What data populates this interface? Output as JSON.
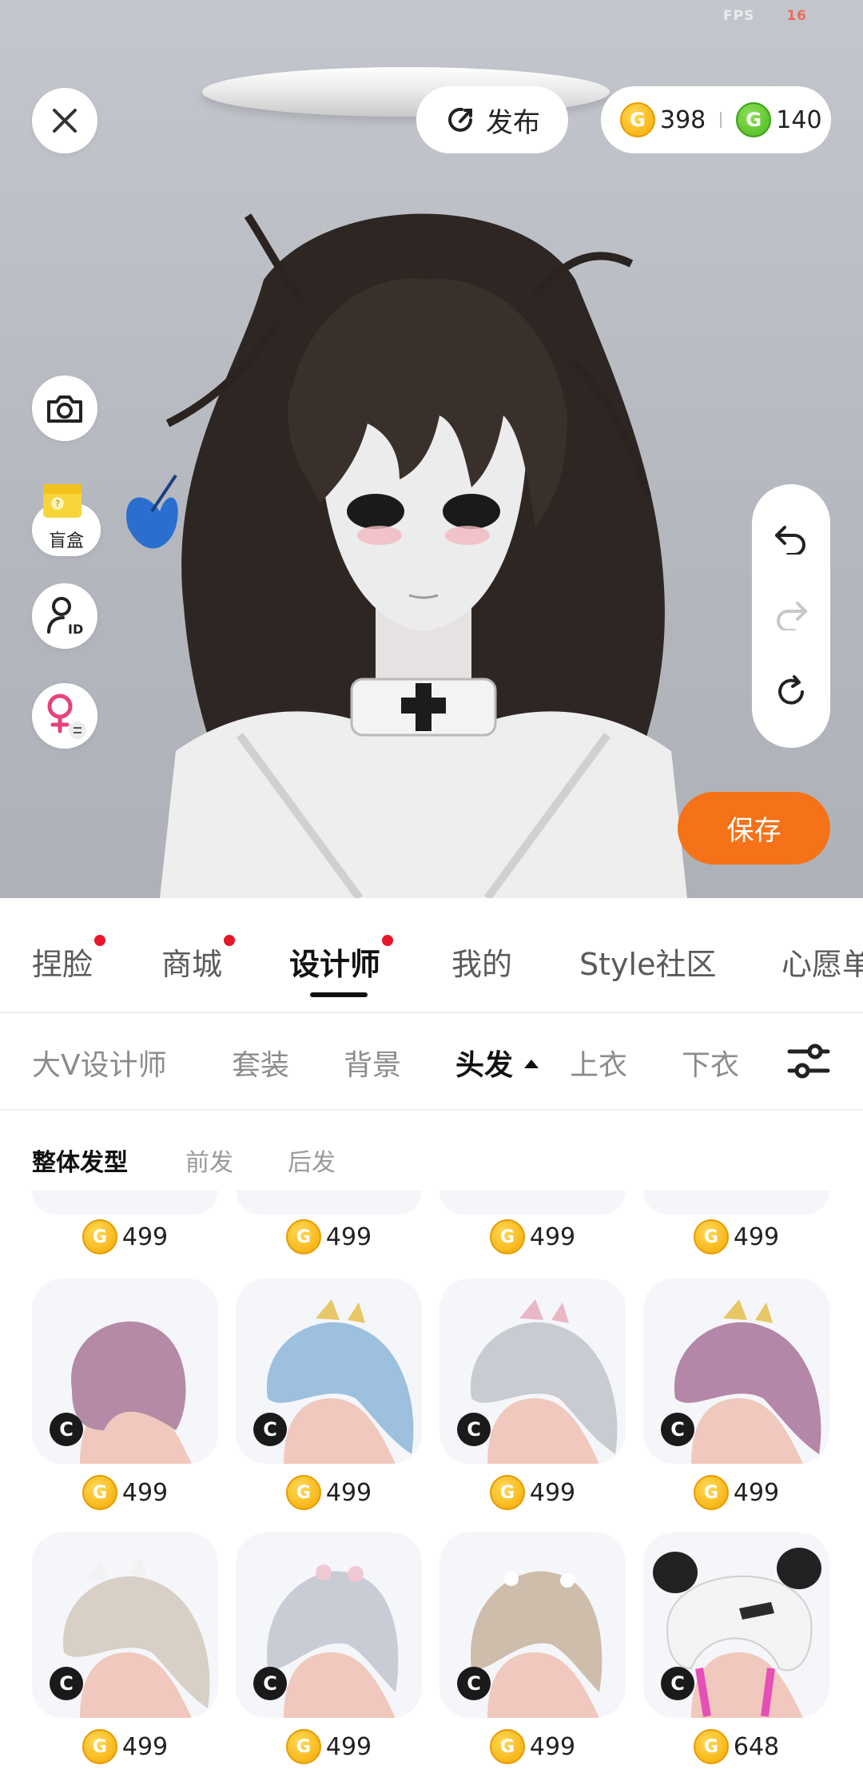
{
  "status": {
    "fps_label": "FPS",
    "fps_value": "16"
  },
  "toolbar": {
    "publish_label": "发布"
  },
  "currency": {
    "gold": "398",
    "green": "140",
    "gold_symbol": "G",
    "green_symbol": "G"
  },
  "side": {
    "mystery_box_label": "盲盒"
  },
  "save_label": "保存",
  "tabs": [
    {
      "label": "捏脸",
      "dot": true
    },
    {
      "label": "商城",
      "dot": true
    },
    {
      "label": "设计师",
      "dot": true,
      "active": true
    },
    {
      "label": "我的",
      "dot": false
    },
    {
      "label": "Style社区",
      "dot": false
    },
    {
      "label": "心愿单",
      "dot": false
    }
  ],
  "subtabs": [
    {
      "label": "大V设计师"
    },
    {
      "label": "套装"
    },
    {
      "label": "背景"
    },
    {
      "label": "头发",
      "active": true
    },
    {
      "label": "上衣"
    },
    {
      "label": "下衣"
    }
  ],
  "style_tabs": [
    {
      "label": "整体发型",
      "active": true
    },
    {
      "label": "前发"
    },
    {
      "label": "后发"
    }
  ],
  "grid": {
    "badge_symbol": "C",
    "row0_prices": [
      "499",
      "499",
      "499",
      "499"
    ],
    "row1_prices": [
      "499",
      "499",
      "499",
      "499"
    ],
    "row2_prices": [
      "499",
      "499",
      "499",
      "648"
    ]
  },
  "colors": {
    "accent_orange": "#f57218",
    "notification_red": "#e8162a",
    "gold_coin": "#f5a900",
    "green_coin": "#48b81b"
  }
}
